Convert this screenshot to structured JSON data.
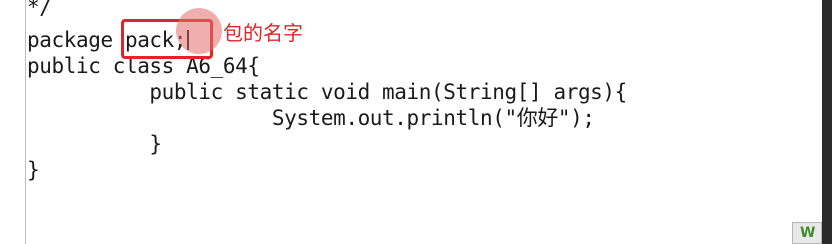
{
  "editor": {
    "lines": [
      "*/",
      "package pack;",
      "public class A6_64{",
      "          public static void main(String[] args){",
      "                    System.out.println(\"你好\");",
      "          }",
      "}"
    ]
  },
  "annotation": {
    "text": "包的名字",
    "color": "#e0242c"
  },
  "tray": {
    "icon": "app-tray-icon",
    "glyph": "W"
  }
}
